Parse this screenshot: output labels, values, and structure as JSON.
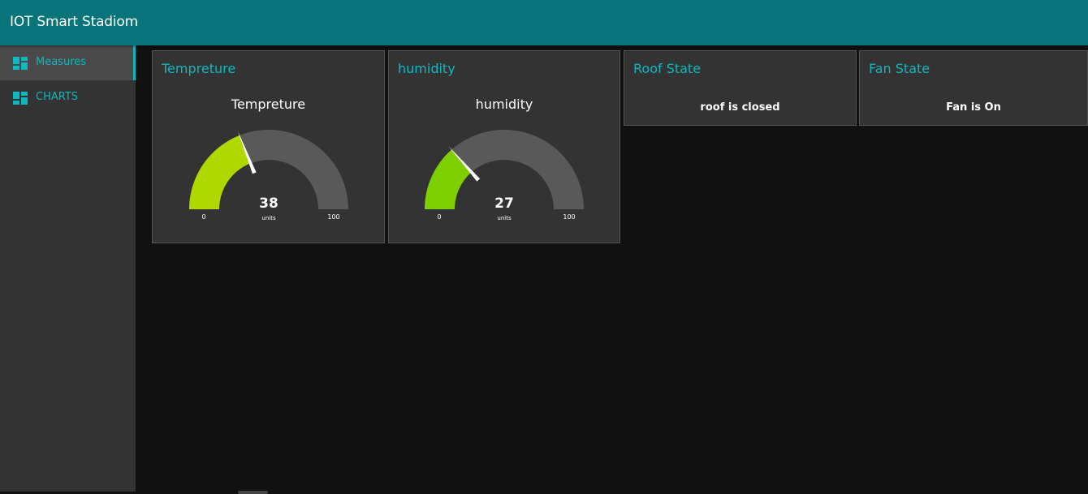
{
  "header": {
    "title": "IOT Smart Stadiom"
  },
  "sidebar": {
    "items": [
      {
        "label": "Measures",
        "icon": "dashboard-icon",
        "active": true
      },
      {
        "label": "CHARTS",
        "icon": "dashboard-icon",
        "active": false
      }
    ]
  },
  "colors": {
    "header": "#097479",
    "accent": "#0eb8c0",
    "card_bg": "#333333",
    "gauge_track": "#595959"
  },
  "cards": {
    "temperature": {
      "title": "Tempreture",
      "gauge_label": "Tempreture",
      "value": 38,
      "value_text": "38",
      "units": "units",
      "min": 0,
      "max": 100,
      "min_text": "0",
      "max_text": "100",
      "fill_color": "#afd700"
    },
    "humidity": {
      "title": "humidity",
      "gauge_label": "humidity",
      "value": 27,
      "value_text": "27",
      "units": "units",
      "min": 0,
      "max": 100,
      "min_text": "0",
      "max_text": "100",
      "fill_color": "#7ecf00"
    },
    "roof": {
      "title": "Roof State",
      "text": "roof is closed"
    },
    "fan": {
      "title": "Fan State",
      "text": "Fan is On"
    }
  }
}
